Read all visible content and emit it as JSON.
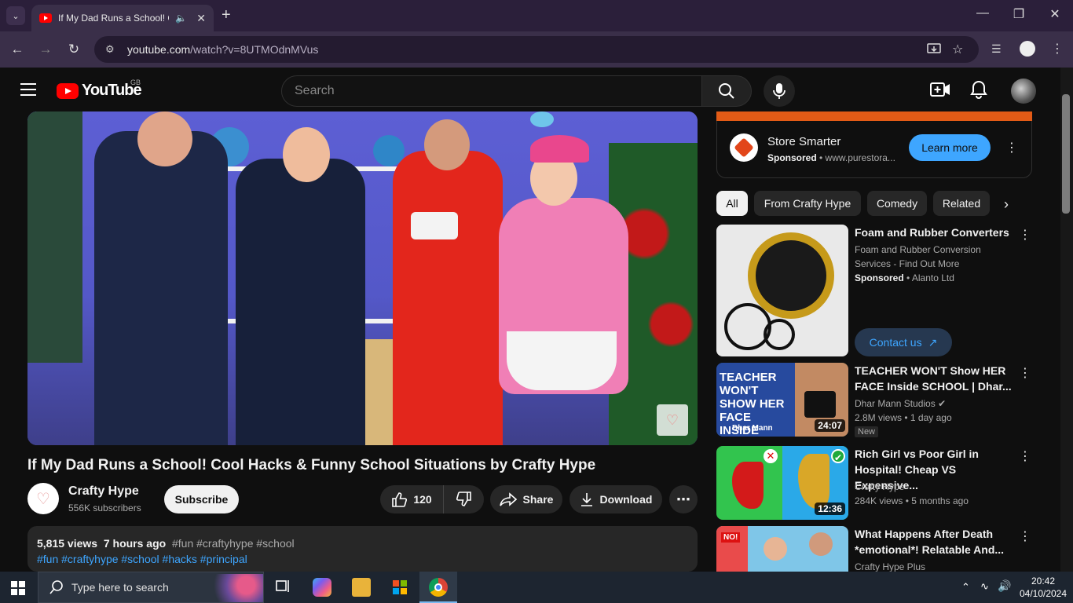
{
  "browser": {
    "tab_title": "If My Dad Runs a School! Cool Hacks & Funny School Situations by Crafty Hype",
    "url_host": "youtube.com",
    "url_path": "/watch?v=8UTMOdnMVus"
  },
  "header": {
    "wordmark": "YouTube",
    "region": "GB",
    "search_placeholder": "Search"
  },
  "video": {
    "title": "If My Dad Runs a School! Cool Hacks & Funny School Situations by Crafty Hype",
    "channel_name": "Crafty Hype",
    "subscribers": "556K subscribers",
    "subscribe_label": "Subscribe",
    "likes": "120",
    "share_label": "Share",
    "download_label": "Download",
    "views": "5,815 views",
    "age": "7 hours ago",
    "meta_tags": "#fun #craftyhype #school",
    "desc_tags": "#fun #craftyhype #school #hacks #principal"
  },
  "ad": {
    "title": "Store Smarter",
    "sponsored": "Sponsored",
    "domain": "www.purestora...",
    "cta": "Learn more"
  },
  "chips": [
    "All",
    "From Crafty Hype",
    "Comedy",
    "Related"
  ],
  "related": [
    {
      "title": "Foam and Rubber Converters",
      "line1": "Foam and Rubber Conversion",
      "line2": "Services - Find Out More",
      "sponsored": "Sponsored",
      "advertiser": "Alanto Ltd",
      "cta": "Contact us"
    },
    {
      "title": "TEACHER WON'T Show HER FACE Inside SCHOOL | Dhar...",
      "thumb_text": "TEACHER WON'T SHOW HER FACE INSIDE SCHOOL",
      "thumb_brand": "Dhar Mann",
      "channel": "Dhar Mann Studios",
      "views": "2.8M views",
      "age": "1 day ago",
      "badge": "New",
      "duration": "24:07"
    },
    {
      "title": "Rich Girl vs Poor Girl in Hospital! Cheap VS Expensive...",
      "channel": "Crafty Hype",
      "views": "284K views",
      "age": "5 months ago",
      "duration": "12:36"
    },
    {
      "title": "What Happens After Death *emotional*! Relatable And...",
      "channel": "Crafty Hype Plus",
      "thumb_text": "NO!"
    }
  ],
  "taskbar": {
    "search_placeholder": "Type here to search",
    "time": "20:42",
    "date": "04/10/2024"
  },
  "colors": {
    "brand_red": "#ff0000",
    "link_blue": "#3ea6ff",
    "ad_orange": "#e35b16"
  }
}
